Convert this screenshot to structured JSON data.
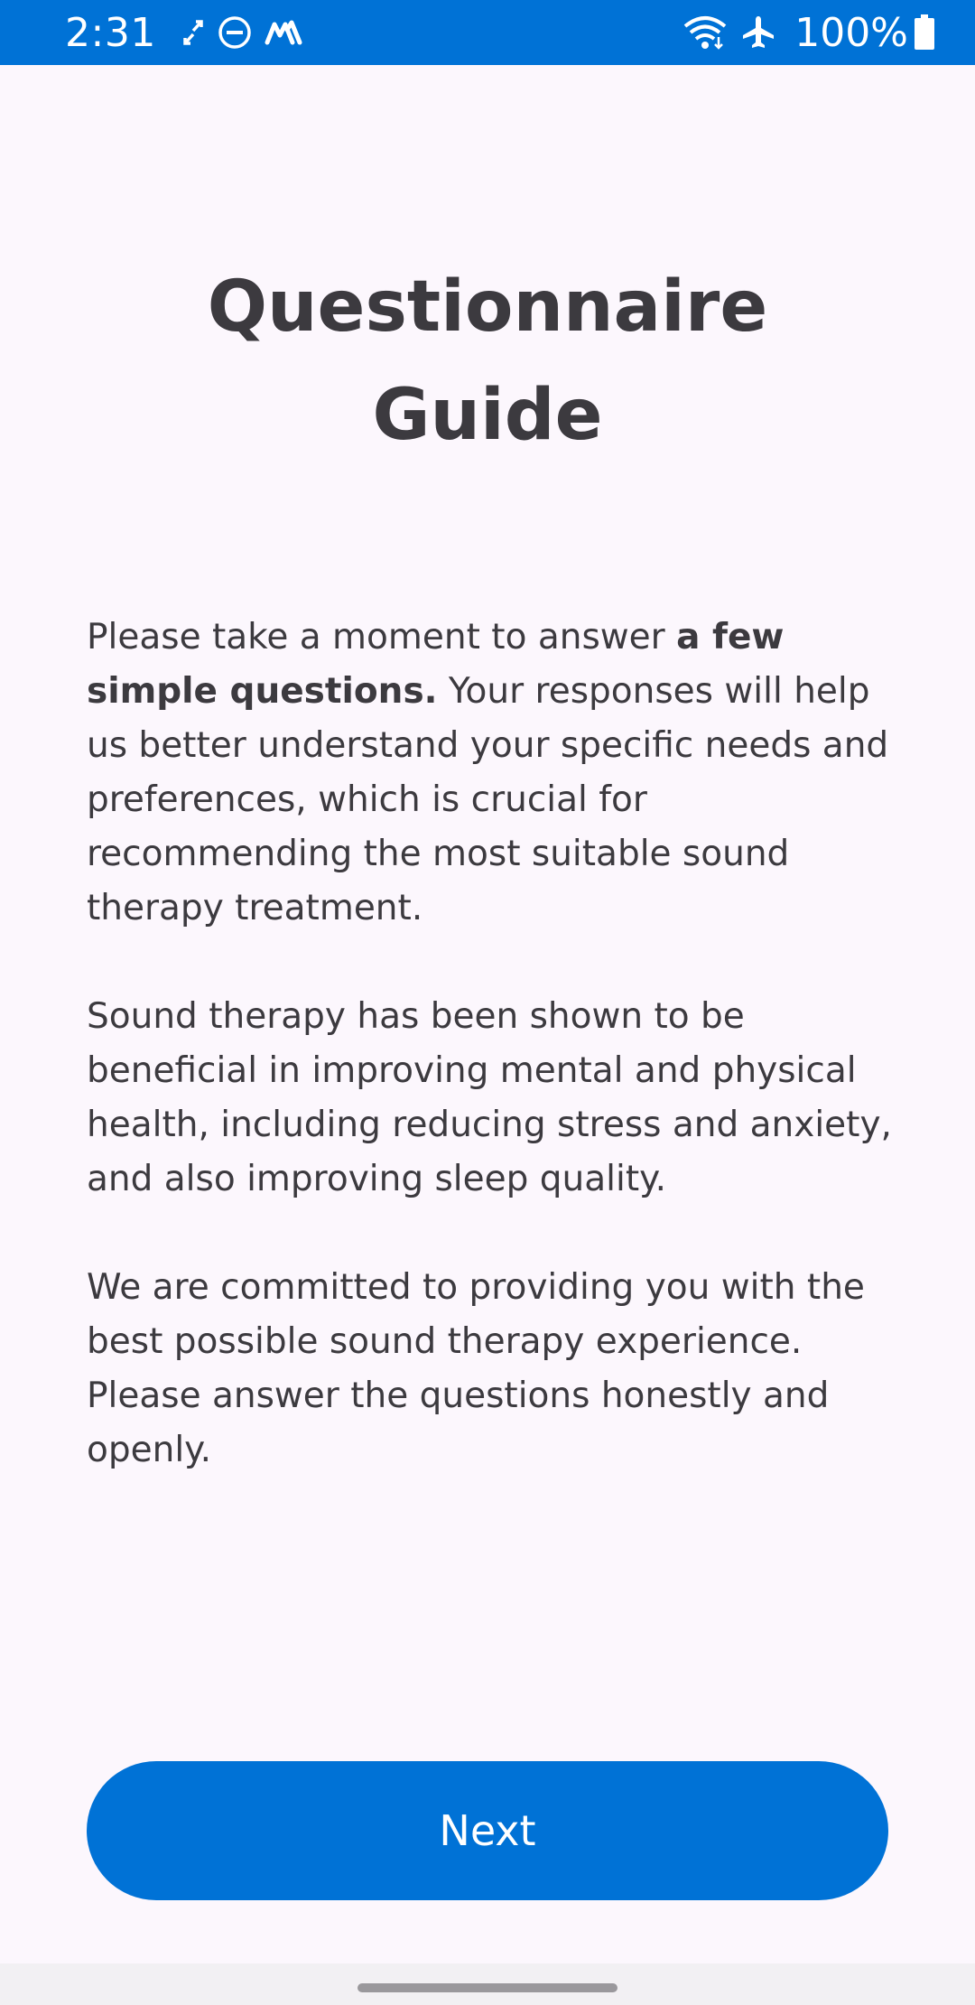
{
  "status_bar": {
    "time": "2:31",
    "battery_percent": "100%",
    "icons": [
      "sync-icon",
      "do-not-disturb-icon",
      "app-notification-icon",
      "wifi-icon",
      "airplane-mode-icon",
      "battery-icon"
    ]
  },
  "title": {
    "line1": "Questionnaire",
    "line2": "Guide"
  },
  "intro": {
    "p1_lead": "Please take a moment to answer ",
    "p1_bold": "a few simple questions.",
    "p1_rest": " Your responses will help us better understand your specific needs and preferences, which is crucial for recommending the most suitable sound therapy treatment.",
    "p2": "Sound therapy has been shown to be beneficial in improving mental and physical health, including reducing stress and anxiety, and also improving sleep quality.",
    "p3": "We are committed to providing you with the best possible sound therapy experience. Please answer the questions honestly and openly."
  },
  "actions": {
    "next_label": "Next"
  },
  "colors": {
    "accent": "#0072d6",
    "background": "#fcf7fd",
    "text": "#3c3a3f"
  }
}
